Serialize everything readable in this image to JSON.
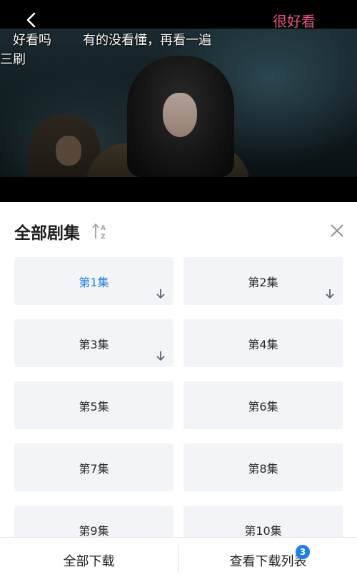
{
  "video": {
    "danmaku": [
      {
        "text": "很好看",
        "color": "#e1547f"
      },
      {
        "text": "好看吗"
      },
      {
        "text": "有的没看懂，再看一遍"
      },
      {
        "text": "三刷"
      }
    ]
  },
  "panel": {
    "title": "全部剧集",
    "sort_icon": "sort-az-icon",
    "close_icon": "close-icon",
    "episodes": [
      {
        "label": "第1集",
        "active": true,
        "downloaded": true
      },
      {
        "label": "第2集",
        "active": false,
        "downloaded": true
      },
      {
        "label": "第3集",
        "active": false,
        "downloaded": true
      },
      {
        "label": "第4集",
        "active": false,
        "downloaded": false
      },
      {
        "label": "第5集",
        "active": false,
        "downloaded": false
      },
      {
        "label": "第6集",
        "active": false,
        "downloaded": false
      },
      {
        "label": "第7集",
        "active": false,
        "downloaded": false
      },
      {
        "label": "第8集",
        "active": false,
        "downloaded": false
      },
      {
        "label": "第9集",
        "active": false,
        "downloaded": false
      },
      {
        "label": "第10集",
        "active": false,
        "downloaded": false
      }
    ]
  },
  "bottom_bar": {
    "download_all_label": "全部下载",
    "view_list_label": "查看下载列表",
    "badge_count": "3"
  },
  "colors": {
    "accent": "#1f7fe6",
    "danmaku_pink": "#e1547f",
    "episode_bg": "#f2f4f7"
  }
}
